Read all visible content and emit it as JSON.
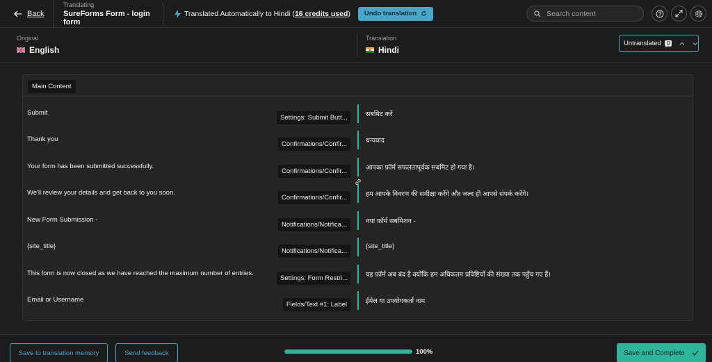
{
  "header": {
    "back_label": "Back",
    "translating_label": "Translating",
    "document_title": "SureForms Form - login form",
    "auto_text": "Translated Automatically to Hindi (",
    "credits_text": "16 credits used",
    "auto_text_end": ")",
    "undo_label": "Undo translation",
    "search_placeholder": "Search content"
  },
  "languages": {
    "original_caption": "Original",
    "original_name": "English",
    "translation_caption": "Translation",
    "translation_name": "Hindi",
    "filter_label": "Untranslated",
    "filter_count": "0"
  },
  "content": {
    "section_label": "Main Content",
    "rows": [
      {
        "source": "Submit",
        "context": "Settings: Submit Butt...",
        "target": "सबमिट करें"
      },
      {
        "source": "Thank you",
        "context": "Confirmations/Confir...",
        "target": "धन्यवाद"
      },
      {
        "source": "Your form has been submitted successfully.",
        "context": "Confirmations/Confir...",
        "target": "आपका फ़ॉर्म सफलतापूर्वक सबमिट हो गया है।"
      },
      {
        "source": "We'll review your details and get back to you soon.",
        "context": "Confirmations/Confir...",
        "target": "हम आपके विवरण की समीक्षा करेंगे और जल्द ही आपसे संपर्क करेंगे।"
      },
      {
        "source": "New Form Submission -",
        "context": "Notifications/Notifica...",
        "target": "नया फ़ॉर्म सबमिशन -"
      },
      {
        "source": "{site_title}",
        "context": "Notifications/Notifica...",
        "target": "{site_title}"
      },
      {
        "source": "This form is now closed as we have reached the maximum number of entries.",
        "context": "Settings: Form Restri...",
        "target": "यह फ़ॉर्म अब बंद है क्योंकि हम अधिकतम प्रविष्टियों की संख्या तक पहुँच गए हैं।"
      },
      {
        "source": "Email or Username",
        "context": "Fields/Text #1: Label",
        "target": "ईमेल या उपयोगकर्ता नाम"
      }
    ]
  },
  "footer": {
    "save_memory_label": "Save to translation memory",
    "feedback_label": "Send feedback",
    "progress_fraction": 1.0,
    "progress_text": "100%",
    "save_complete_label": "Save and Complete"
  },
  "colors": {
    "accent_teal": "#2fb59a",
    "accent_blue": "#4aa6c9",
    "background": "#1e1e1e"
  }
}
